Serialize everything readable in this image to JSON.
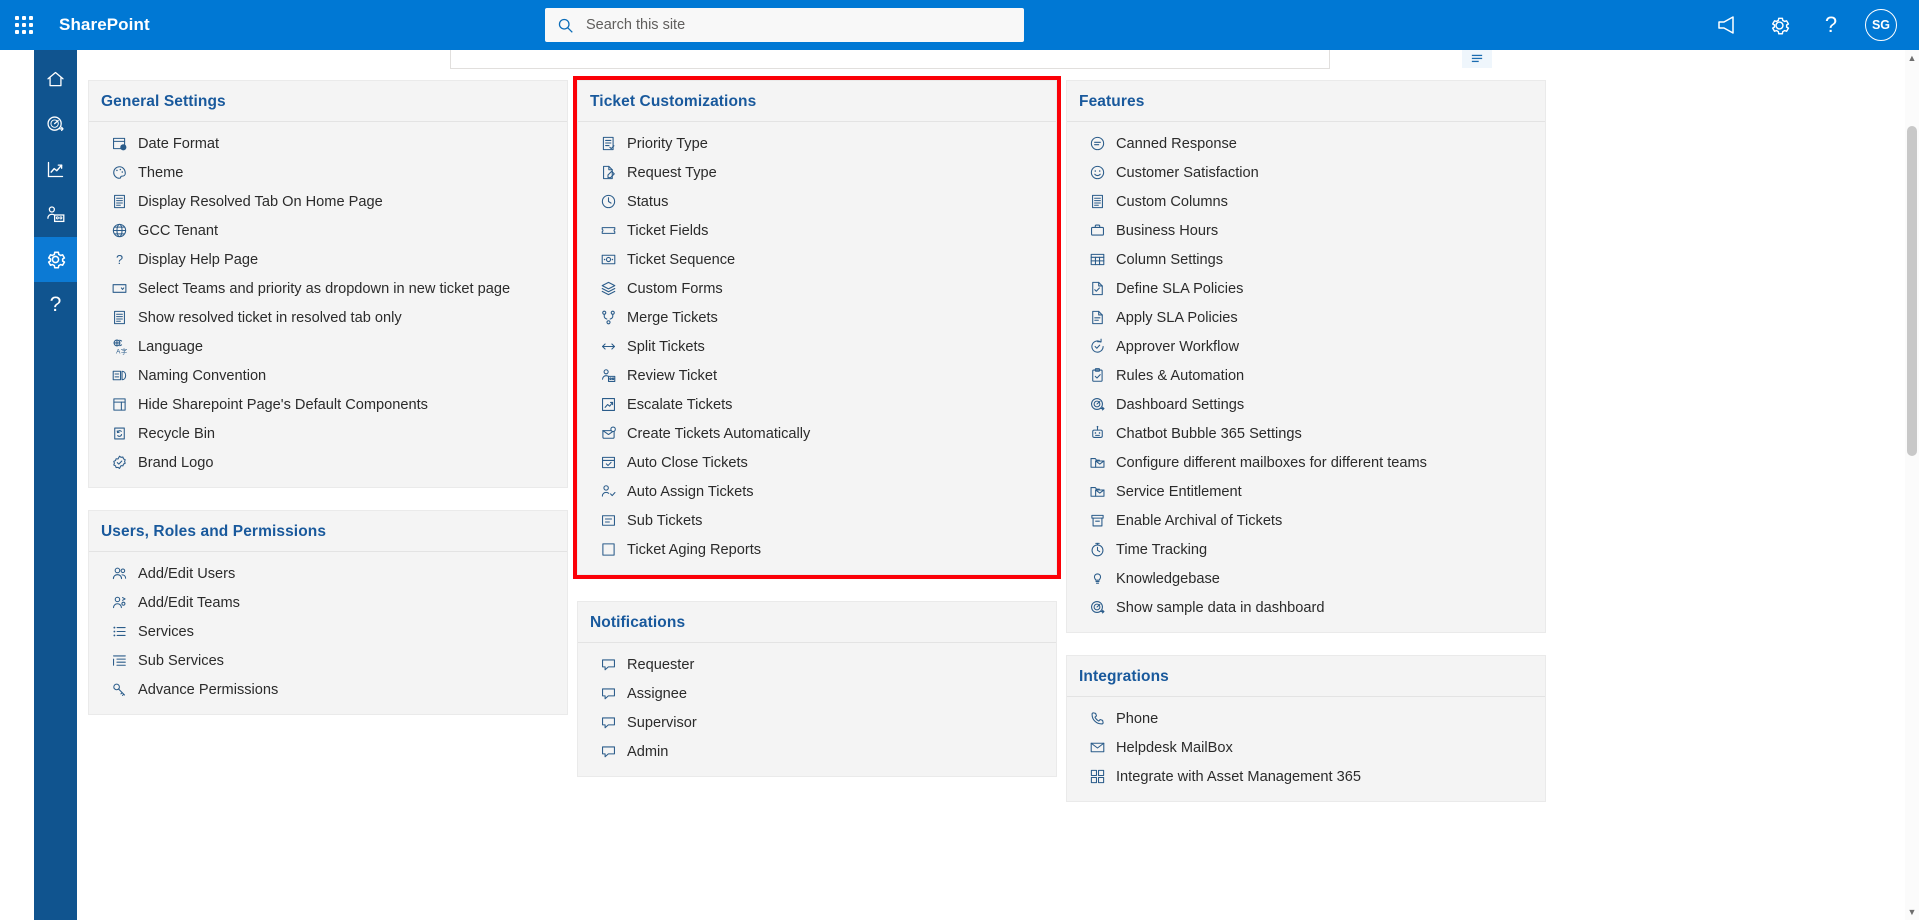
{
  "header": {
    "brand": "SharePoint",
    "waffle_icon": "app-launcher-icon",
    "search": {
      "placeholder": "Search this site",
      "value": "",
      "icon": "search-icon"
    },
    "actions": [
      {
        "name": "megaphone-icon",
        "label": ""
      },
      {
        "name": "gear-icon",
        "label": ""
      },
      {
        "name": "help-icon",
        "label": "?"
      }
    ],
    "avatar_initials": "SG",
    "accent_color": "#0078d4"
  },
  "rail": {
    "items": [
      {
        "name": "home-icon",
        "active": false
      },
      {
        "name": "dashboard-gauge-icon",
        "active": false
      },
      {
        "name": "analytics-chart-icon",
        "active": false
      },
      {
        "name": "team-management-icon",
        "active": false
      },
      {
        "name": "settings-gear-icon",
        "active": true
      },
      {
        "name": "help-question-icon",
        "active": false
      }
    ],
    "active_color": "#0c7ad4",
    "background_color": "#10548f"
  },
  "highlight": {
    "color": "#fb0007",
    "target": "Ticket Customizations"
  },
  "columns": [
    {
      "id": "column-left",
      "cards": [
        {
          "id": "general-settings",
          "title": "General Settings",
          "highlighted": false,
          "items": [
            {
              "label": "Date Format",
              "icon": "date-format-icon"
            },
            {
              "label": "Theme",
              "icon": "palette-icon"
            },
            {
              "label": "Display Resolved Tab On Home Page",
              "icon": "list-document-icon"
            },
            {
              "label": "GCC Tenant",
              "icon": "globe-icon"
            },
            {
              "label": "Display Help Page",
              "icon": "question-mark-icon"
            },
            {
              "label": "Select Teams and priority as dropdown in new ticket page",
              "icon": "dropdown-box-icon"
            },
            {
              "label": "Show resolved ticket in resolved tab only",
              "icon": "list-document-icon"
            },
            {
              "label": "Language",
              "icon": "language-translate-icon"
            },
            {
              "label": "Naming Convention",
              "icon": "naming-convention-icon"
            },
            {
              "label": "Hide Sharepoint Page's Default Components",
              "icon": "page-layout-icon"
            },
            {
              "label": "Recycle Bin",
              "icon": "recycle-bin-icon"
            },
            {
              "label": "Brand Logo",
              "icon": "badge-check-icon"
            }
          ]
        },
        {
          "id": "users-roles-permissions",
          "title": "Users, Roles and Permissions",
          "highlighted": false,
          "items": [
            {
              "label": "Add/Edit Users",
              "icon": "people-icon"
            },
            {
              "label": "Add/Edit Teams",
              "icon": "team-people-icon"
            },
            {
              "label": "Services",
              "icon": "bullet-list-icon"
            },
            {
              "label": "Sub Services",
              "icon": "indent-list-icon"
            },
            {
              "label": "Advance Permissions",
              "icon": "key-icon"
            }
          ]
        }
      ]
    },
    {
      "id": "column-middle",
      "cards": [
        {
          "id": "ticket-customizations",
          "title": "Ticket Customizations",
          "highlighted": true,
          "items": [
            {
              "label": "Priority Type",
              "icon": "priority-list-icon"
            },
            {
              "label": "Request Type",
              "icon": "edit-document-icon"
            },
            {
              "label": "Status",
              "icon": "clock-icon"
            },
            {
              "label": "Ticket Fields",
              "icon": "ticket-icon"
            },
            {
              "label": "Ticket Sequence",
              "icon": "sequence-number-icon"
            },
            {
              "label": "Custom Forms",
              "icon": "layers-icon"
            },
            {
              "label": "Merge Tickets",
              "icon": "merge-icon"
            },
            {
              "label": "Split Tickets",
              "icon": "split-arrows-icon"
            },
            {
              "label": "Review Ticket",
              "icon": "review-person-icon"
            },
            {
              "label": "Escalate Tickets",
              "icon": "escalate-chart-icon"
            },
            {
              "label": "Create Tickets Automatically",
              "icon": "auto-create-icon"
            },
            {
              "label": "Auto Close Tickets",
              "icon": "auto-close-icon"
            },
            {
              "label": "Auto Assign Tickets",
              "icon": "auto-assign-icon"
            },
            {
              "label": "Sub Tickets",
              "icon": "sub-ticket-icon"
            },
            {
              "label": "Ticket Aging Reports",
              "icon": "report-square-icon"
            }
          ]
        },
        {
          "id": "notifications",
          "title": "Notifications",
          "highlighted": false,
          "items": [
            {
              "label": "Requester",
              "icon": "chat-bubble-icon"
            },
            {
              "label": "Assignee",
              "icon": "chat-bubble-icon"
            },
            {
              "label": "Supervisor",
              "icon": "chat-bubble-icon"
            },
            {
              "label": "Admin",
              "icon": "chat-bubble-icon"
            }
          ]
        }
      ]
    },
    {
      "id": "column-right",
      "cards": [
        {
          "id": "features",
          "title": "Features",
          "highlighted": false,
          "items": [
            {
              "label": "Canned Response",
              "icon": "canned-response-icon"
            },
            {
              "label": "Customer Satisfaction",
              "icon": "smiley-icon"
            },
            {
              "label": "Custom Columns",
              "icon": "list-document-icon"
            },
            {
              "label": "Business Hours",
              "icon": "briefcase-icon"
            },
            {
              "label": "Column Settings",
              "icon": "table-columns-icon"
            },
            {
              "label": "Define SLA Policies",
              "icon": "sla-document-icon"
            },
            {
              "label": "Apply SLA Policies",
              "icon": "sla-apply-icon"
            },
            {
              "label": "Approver Workflow",
              "icon": "approver-workflow-icon"
            },
            {
              "label": "Rules & Automation",
              "icon": "clipboard-check-icon"
            },
            {
              "label": "Dashboard Settings",
              "icon": "dashboard-gauge-icon"
            },
            {
              "label": "Chatbot Bubble 365 Settings",
              "icon": "chatbot-icon"
            },
            {
              "label": "Configure different mailboxes for different teams",
              "icon": "mailbox-folder-icon"
            },
            {
              "label": "Service Entitlement",
              "icon": "mailbox-folder-icon"
            },
            {
              "label": "Enable Archival of Tickets",
              "icon": "archive-box-icon"
            },
            {
              "label": "Time Tracking",
              "icon": "stopwatch-icon"
            },
            {
              "label": "Knowledgebase",
              "icon": "lightbulb-icon"
            },
            {
              "label": "Show sample data in dashboard",
              "icon": "dashboard-gauge-icon"
            }
          ]
        },
        {
          "id": "integrations",
          "title": "Integrations",
          "highlighted": false,
          "items": [
            {
              "label": "Phone",
              "icon": "phone-icon"
            },
            {
              "label": "Helpdesk MailBox",
              "icon": "envelope-icon"
            },
            {
              "label": "Integrate with Asset Management 365",
              "icon": "asset-grid-icon"
            }
          ]
        }
      ]
    }
  ]
}
